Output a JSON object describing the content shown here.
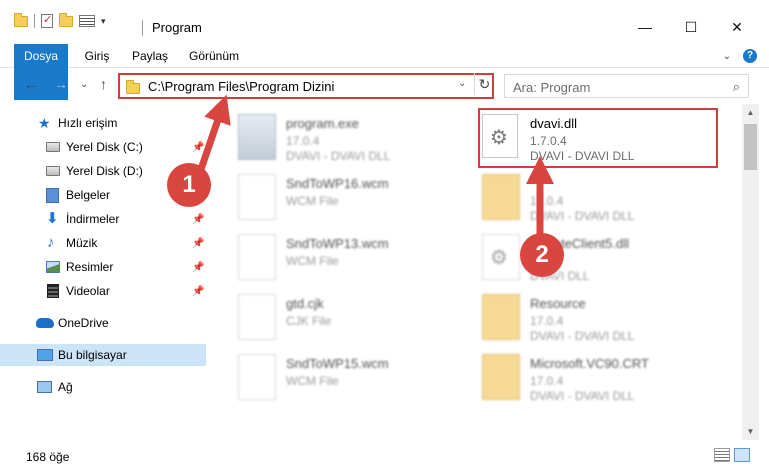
{
  "window": {
    "title": "Program",
    "minimize_glyph": "—",
    "maximize_glyph": "☐",
    "close_glyph": "✕",
    "quick_access_arrow": "▾"
  },
  "ribbon": {
    "tabs": [
      {
        "label": "Dosya"
      },
      {
        "label": "Giriş"
      },
      {
        "label": "Paylaş"
      },
      {
        "label": "Görünüm"
      }
    ],
    "expand_glyph": "⌄",
    "help_glyph": "?"
  },
  "nav": {
    "back_glyph": "←",
    "forward_glyph": "→",
    "recent_glyph": "⌄",
    "up_glyph": "↑",
    "address": "C:\\Program Files\\Program Dizini",
    "address_dropdown_glyph": "⌄",
    "refresh_glyph": "↻",
    "search_placeholder": "Ara: Program",
    "search_glyph": "⌕"
  },
  "sidebar": {
    "items": [
      {
        "label": "Hızlı erişim",
        "icon": "star-icon",
        "glyph": "★"
      },
      {
        "label": "Yerel Disk (C:)",
        "icon": "disk-icon",
        "pinned": true
      },
      {
        "label": "Yerel Disk (D:)",
        "icon": "disk-icon",
        "pinned": true
      },
      {
        "label": "Belgeler",
        "icon": "documents-icon",
        "pinned": true
      },
      {
        "label": "İndirmeler",
        "icon": "download-icon",
        "glyph": "⬇",
        "pinned": true
      },
      {
        "label": "Müzik",
        "icon": "music-icon",
        "glyph": "♪",
        "pinned": true
      },
      {
        "label": "Resimler",
        "icon": "pictures-icon",
        "pinned": true
      },
      {
        "label": "Videolar",
        "icon": "video-icon",
        "pinned": true
      },
      {
        "label": "OneDrive",
        "icon": "cloud-icon"
      },
      {
        "label": "Bu bilgisayar",
        "icon": "computer-icon",
        "selected": true
      },
      {
        "label": "Ağ",
        "icon": "network-icon"
      }
    ],
    "pin_glyph": "📌"
  },
  "files": {
    "left": [
      {
        "name": "program.exe",
        "line2": "17.0.4",
        "line3": "DVAVI - DVAVI DLL",
        "kind": "exe"
      },
      {
        "name": "SndToWP16.wcm",
        "line2": "WCM File",
        "line3": "",
        "kind": "page"
      },
      {
        "name": "SndToWP13.wcm",
        "line2": "WCM File",
        "line3": "",
        "kind": "page"
      },
      {
        "name": "gtd.cjk",
        "line2": "CJK File",
        "line3": "",
        "kind": "page"
      },
      {
        "name": "SndToWP15.wcm",
        "line2": "WCM File",
        "line3": "",
        "kind": "page"
      }
    ],
    "right": [
      {
        "name": "dvavi.dll",
        "line2": "1.7.0.4",
        "line3": "DVAVI - DVAVI DLL",
        "kind": "dll"
      },
      {
        "name": "",
        "line2": "17.0.4",
        "line3": "DVAVI - DVAVI DLL",
        "kind": "folder"
      },
      {
        "name": "UpdateClient5.dll",
        "line2": "",
        "line3": "DVAVI DLL",
        "kind": "dll"
      },
      {
        "name": "Resource",
        "line2": "17.0.4",
        "line3": "DVAVI - DVAVI DLL",
        "kind": "folder"
      },
      {
        "name": "Microsoft.VC90.CRT",
        "line2": "17.0.4",
        "line3": "DVAVI - DVAVI DLL",
        "kind": "folder"
      }
    ]
  },
  "status": {
    "item_count": "168 öğe"
  },
  "annotations": {
    "callout_1": "1",
    "callout_2": "2",
    "color": "#d9453f"
  },
  "colors": {
    "accent": "#1979ca",
    "selection": "#cce4f7",
    "highlight_border": "#d43c3c"
  }
}
